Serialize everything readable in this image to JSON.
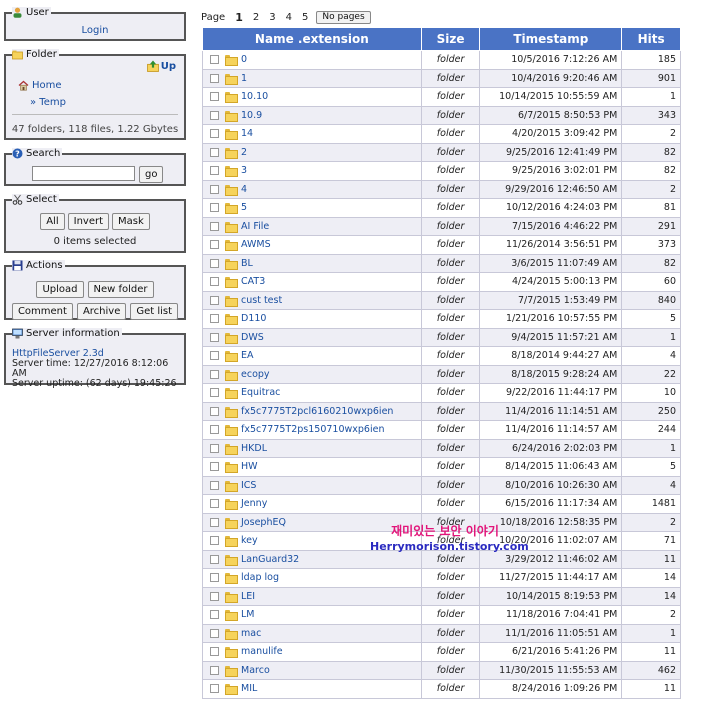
{
  "sidebar": {
    "user": {
      "title": "User",
      "login_label": "Login"
    },
    "folder": {
      "title": "Folder",
      "up_label": "Up",
      "home_label": "Home",
      "current_label": "» Temp",
      "stats": "47 folders, 118 files, 1.22 Gbytes"
    },
    "search": {
      "title": "Search",
      "input_value": "",
      "go_label": "go"
    },
    "select": {
      "title": "Select",
      "all_label": "All",
      "invert_label": "Invert",
      "mask_label": "Mask",
      "status": "0 items selected"
    },
    "actions": {
      "title": "Actions",
      "upload_label": "Upload",
      "new_folder_label": "New folder",
      "comment_label": "Comment",
      "archive_label": "Archive",
      "get_list_label": "Get list"
    },
    "server": {
      "title": "Server information",
      "link": "HttpFileServer 2.3d",
      "time": "Server time: 12/27/2016 8:12:06 AM",
      "uptime": "Server uptime: (62 days) 19:45:26"
    }
  },
  "pager": {
    "label": "Page",
    "pages": [
      "1",
      "2",
      "3",
      "4",
      "5"
    ],
    "current": "1",
    "no_pages_label": "No pages"
  },
  "table": {
    "headers": {
      "name": "Name .extension",
      "size": "Size",
      "timestamp": "Timestamp",
      "hits": "Hits"
    },
    "rows": [
      {
        "name": "0",
        "size": "folder",
        "time": "10/5/2016 7:12:26 AM",
        "hits": "185"
      },
      {
        "name": "1",
        "size": "folder",
        "time": "10/4/2016 9:20:46 AM",
        "hits": "901"
      },
      {
        "name": "10.10",
        "size": "folder",
        "time": "10/14/2015 10:55:59 AM",
        "hits": "1"
      },
      {
        "name": "10.9",
        "size": "folder",
        "time": "6/7/2015 8:50:53 PM",
        "hits": "343"
      },
      {
        "name": "14",
        "size": "folder",
        "time": "4/20/2015 3:09:42 PM",
        "hits": "2"
      },
      {
        "name": "2",
        "size": "folder",
        "time": "9/25/2016 12:41:49 PM",
        "hits": "82"
      },
      {
        "name": "3",
        "size": "folder",
        "time": "9/25/2016 3:02:01 PM",
        "hits": "82"
      },
      {
        "name": "4",
        "size": "folder",
        "time": "9/29/2016 12:46:50 AM",
        "hits": "2"
      },
      {
        "name": "5",
        "size": "folder",
        "time": "10/12/2016 4:24:03 PM",
        "hits": "81"
      },
      {
        "name": "AI File",
        "size": "folder",
        "time": "7/15/2016 4:46:22 PM",
        "hits": "291"
      },
      {
        "name": "AWMS",
        "size": "folder",
        "time": "11/26/2014 3:56:51 PM",
        "hits": "373"
      },
      {
        "name": "BL",
        "size": "folder",
        "time": "3/6/2015 11:07:49 AM",
        "hits": "82"
      },
      {
        "name": "CAT3",
        "size": "folder",
        "time": "4/24/2015 5:00:13 PM",
        "hits": "60"
      },
      {
        "name": "cust test",
        "size": "folder",
        "time": "7/7/2015 1:53:49 PM",
        "hits": "840"
      },
      {
        "name": "D110",
        "size": "folder",
        "time": "1/21/2016 10:57:55 PM",
        "hits": "5"
      },
      {
        "name": "DWS",
        "size": "folder",
        "time": "9/4/2015 11:57:21 AM",
        "hits": "1"
      },
      {
        "name": "EA",
        "size": "folder",
        "time": "8/18/2014 9:44:27 AM",
        "hits": "4"
      },
      {
        "name": "ecopy",
        "size": "folder",
        "time": "8/18/2015 9:28:24 AM",
        "hits": "22"
      },
      {
        "name": "Equitrac",
        "size": "folder",
        "time": "9/22/2016 11:44:17 PM",
        "hits": "10"
      },
      {
        "name": "fx5c7775T2pcl6160210wxp6ien",
        "size": "folder",
        "time": "11/4/2016 11:14:51 AM",
        "hits": "250"
      },
      {
        "name": "fx5c7775T2ps150710wxp6ien",
        "size": "folder",
        "time": "11/4/2016 11:14:57 AM",
        "hits": "244"
      },
      {
        "name": "HKDL",
        "size": "folder",
        "time": "6/24/2016 2:02:03 PM",
        "hits": "1"
      },
      {
        "name": "HW",
        "size": "folder",
        "time": "8/14/2015 11:06:43 AM",
        "hits": "5"
      },
      {
        "name": "ICS",
        "size": "folder",
        "time": "8/10/2016 10:26:30 AM",
        "hits": "4"
      },
      {
        "name": "Jenny",
        "size": "folder",
        "time": "6/15/2016 11:17:34 AM",
        "hits": "1481"
      },
      {
        "name": "JosephEQ",
        "size": "folder",
        "time": "10/18/2016 12:58:35 PM",
        "hits": "2"
      },
      {
        "name": "key",
        "size": "folder",
        "time": "10/20/2016 11:02:07 AM",
        "hits": "71"
      },
      {
        "name": "LanGuard32",
        "size": "folder",
        "time": "3/29/2012 11:46:02 AM",
        "hits": "11"
      },
      {
        "name": "ldap log",
        "size": "folder",
        "time": "11/27/2015 11:44:17 AM",
        "hits": "14"
      },
      {
        "name": "LEI",
        "size": "folder",
        "time": "10/14/2015 8:19:53 PM",
        "hits": "14"
      },
      {
        "name": "LM",
        "size": "folder",
        "time": "11/18/2016 7:04:41 PM",
        "hits": "2"
      },
      {
        "name": "mac",
        "size": "folder",
        "time": "11/1/2016 11:05:51 AM",
        "hits": "1"
      },
      {
        "name": "manulife",
        "size": "folder",
        "time": "6/21/2016 5:41:26 PM",
        "hits": "11"
      },
      {
        "name": "Marco",
        "size": "folder",
        "time": "11/30/2015 11:55:53 AM",
        "hits": "462"
      },
      {
        "name": "MIL",
        "size": "folder",
        "time": "8/24/2016 1:09:26 PM",
        "hits": "11"
      }
    ]
  },
  "watermark": {
    "line1": "재미있는 보안 이야기",
    "line2": "Herrymorison.tistory.com"
  }
}
